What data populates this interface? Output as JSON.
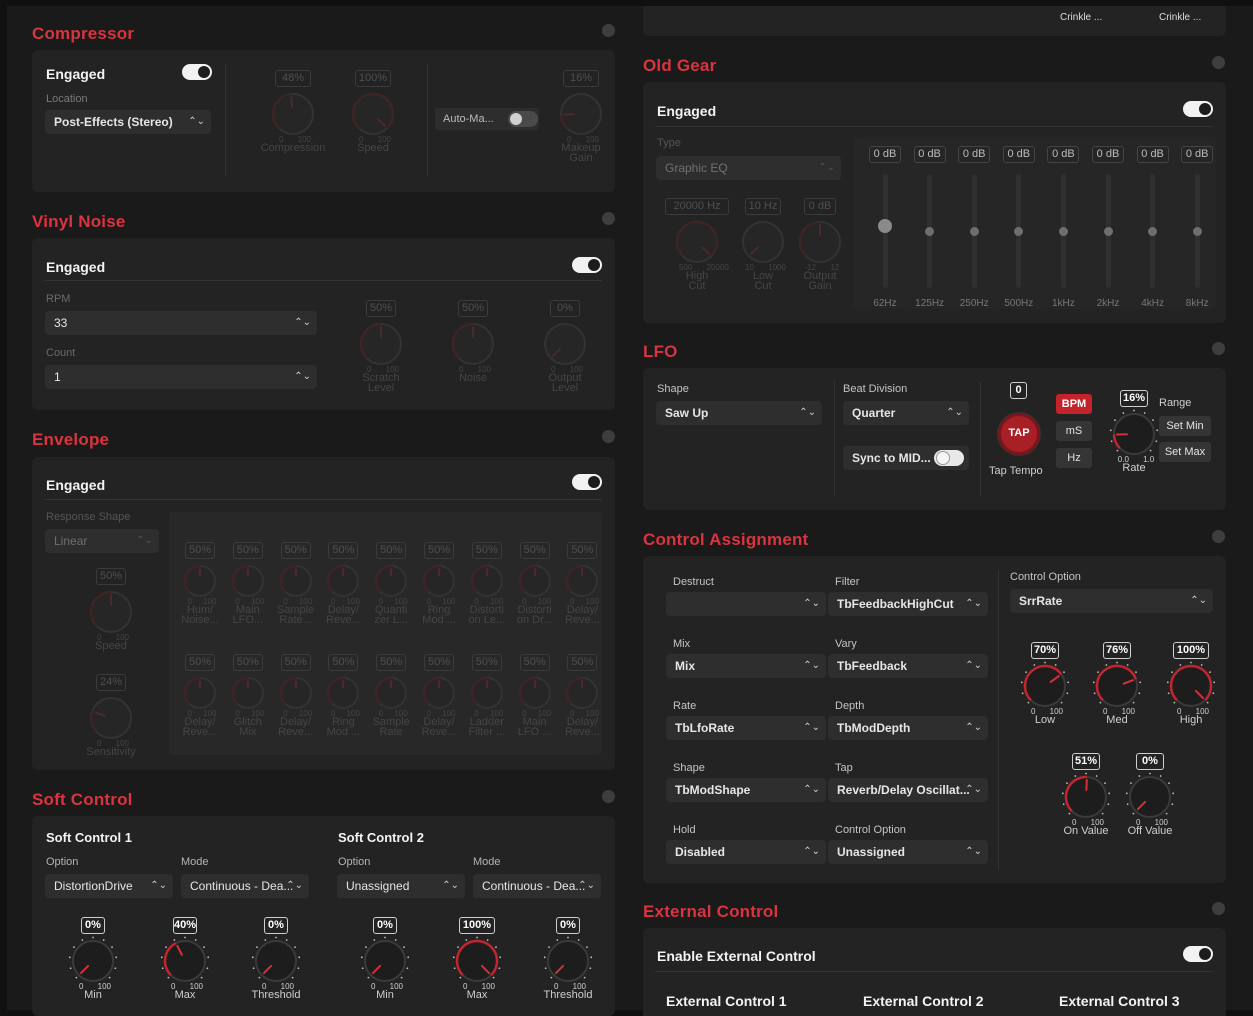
{
  "top_crinkle": [
    "Crinkle ...",
    "Crinkle ..."
  ],
  "compressor": {
    "title": "Compressor",
    "engaged": "Engaged",
    "location_label": "Location",
    "location": "Post-Effects (Stereo)",
    "auto_makeup": "Auto-Ma...",
    "knobs": [
      {
        "value": "48%",
        "label": "Compression",
        "pct": 0.48
      },
      {
        "value": "100%",
        "label": "Speed",
        "pct": 1.0
      },
      {
        "value": "16%",
        "label": "Makeup Gain",
        "pct": 0.16
      }
    ]
  },
  "vinyl": {
    "title": "Vinyl Noise",
    "engaged": "Engaged",
    "rpm_label": "RPM",
    "rpm": "33",
    "count_label": "Count",
    "count": "1",
    "knobs": [
      {
        "value": "50%",
        "label": "Scratch Level",
        "pct": 0.5
      },
      {
        "value": "50%",
        "label": "Noise",
        "pct": 0.5
      },
      {
        "value": "0%",
        "label": "Output Level",
        "pct": 0.0
      }
    ]
  },
  "envelope": {
    "title": "Envelope",
    "engaged": "Engaged",
    "shape_label": "Response Shape",
    "shape": "Linear",
    "speed": {
      "value": "50%",
      "label": "Speed",
      "pct": 0.5
    },
    "sens": {
      "value": "24%",
      "label": "Sensitivity",
      "pct": 0.24
    },
    "row1": [
      {
        "value": "50%",
        "l1": "Hum/",
        "l2": "Noise..."
      },
      {
        "value": "50%",
        "l1": "Main",
        "l2": "LFO..."
      },
      {
        "value": "50%",
        "l1": "Sample",
        "l2": "Rate..."
      },
      {
        "value": "50%",
        "l1": "Delay/",
        "l2": "Reve..."
      },
      {
        "value": "50%",
        "l1": "Quanti",
        "l2": "zer L..."
      },
      {
        "value": "50%",
        "l1": "Ring",
        "l2": "Mod ..."
      },
      {
        "value": "50%",
        "l1": "Distorti",
        "l2": "on Le..."
      },
      {
        "value": "50%",
        "l1": "Distorti",
        "l2": "on Dr..."
      },
      {
        "value": "50%",
        "l1": "Delay/",
        "l2": "Reve..."
      }
    ],
    "row2": [
      {
        "value": "50%",
        "l1": "Delay/",
        "l2": "Reve..."
      },
      {
        "value": "50%",
        "l1": "Glitch",
        "l2": "Mix"
      },
      {
        "value": "50%",
        "l1": "Delay/",
        "l2": "Reve..."
      },
      {
        "value": "50%",
        "l1": "Ring",
        "l2": "Mod ..."
      },
      {
        "value": "50%",
        "l1": "Sample",
        "l2": "Rate"
      },
      {
        "value": "50%",
        "l1": "Delay/",
        "l2": "Reve..."
      },
      {
        "value": "50%",
        "l1": "Ladder",
        "l2": "Filter ..."
      },
      {
        "value": "50%",
        "l1": "Main",
        "l2": "LFO ..."
      },
      {
        "value": "50%",
        "l1": "Delay/",
        "l2": "Reve..."
      }
    ]
  },
  "soft": {
    "title": "Soft Control",
    "sc1": {
      "title": "Soft Control 1",
      "option_label": "Option",
      "mode_label": "Mode",
      "option": "DistortionDrive",
      "mode": "Continuous - Dea...",
      "knobs": [
        {
          "value": "0%",
          "label": "Min",
          "pct": 0
        },
        {
          "value": "40%",
          "label": "Max",
          "pct": 0.4
        },
        {
          "value": "0%",
          "label": "Threshold",
          "pct": 0
        }
      ]
    },
    "sc2": {
      "title": "Soft Control 2",
      "option_label": "Option",
      "mode_label": "Mode",
      "option": "Unassigned",
      "mode": "Continuous - Dea...",
      "knobs": [
        {
          "value": "0%",
          "label": "Min",
          "pct": 0
        },
        {
          "value": "100%",
          "label": "Max",
          "pct": 1
        },
        {
          "value": "0%",
          "label": "Threshold",
          "pct": 0
        }
      ]
    }
  },
  "oldgear": {
    "title": "Old Gear",
    "engaged": "Engaged",
    "type_label": "Type",
    "type": "Graphic EQ",
    "knobs": [
      {
        "value": "20000 Hz",
        "label": "High Cut",
        "min": "500",
        "max": "20000",
        "pct": 1.0
      },
      {
        "value": "10 Hz",
        "label": "Low Cut",
        "min": "10",
        "max": "1000",
        "pct": 0.0
      },
      {
        "value": "0 dB",
        "label": "Output Gain",
        "min": "-12",
        "max": "12",
        "pct": 0.5
      }
    ],
    "bands": [
      {
        "value": "0 dB",
        "freq": "62Hz",
        "level": 0.5
      },
      {
        "value": "0 dB",
        "freq": "125Hz",
        "level": 0.5
      },
      {
        "value": "0 dB",
        "freq": "250Hz",
        "level": 0.5
      },
      {
        "value": "0 dB",
        "freq": "500Hz",
        "level": 0.5
      },
      {
        "value": "0 dB",
        "freq": "1kHz",
        "level": 0.5
      },
      {
        "value": "0 dB",
        "freq": "2kHz",
        "level": 0.5
      },
      {
        "value": "0 dB",
        "freq": "4kHz",
        "level": 0.5
      },
      {
        "value": "0 dB",
        "freq": "8kHz",
        "level": 0.5
      }
    ]
  },
  "lfo": {
    "title": "LFO",
    "shape_label": "Shape",
    "shape": "Saw Up",
    "beat_label": "Beat Division",
    "beat": "Quarter",
    "sync": "Sync to MID...",
    "tap_count": "0",
    "tap": "TAP",
    "tap_label": "Tap Tempo",
    "bpm": "BPM",
    "ms": "mS",
    "hz": "Hz",
    "rate": {
      "value": "16%",
      "label": "Rate",
      "min": "0.0",
      "max": "1.0",
      "pct": 0.16
    },
    "range_label": "Range",
    "set_min": "Set Min",
    "set_max": "Set Max"
  },
  "control": {
    "title": "Control Assignment",
    "fields": [
      {
        "label": "Destruct",
        "value": ""
      },
      {
        "label": "Filter",
        "value": "TbFeedbackHighCut"
      },
      {
        "label": "Mix",
        "value": "Mix"
      },
      {
        "label": "Vary",
        "value": "TbFeedback"
      },
      {
        "label": "Rate",
        "value": "TbLfoRate"
      },
      {
        "label": "Depth",
        "value": "TbModDepth"
      },
      {
        "label": "Shape",
        "value": "TbModShape"
      },
      {
        "label": "Tap",
        "value": "Reverb/Delay Oscillat..."
      },
      {
        "label": "Hold",
        "value": "Disabled"
      },
      {
        "label": "Control Option",
        "value": "Unassigned"
      }
    ],
    "option_label": "Control Option",
    "option": "SrrRate",
    "knobs": [
      {
        "value": "70%",
        "label": "Low",
        "pct": 0.7
      },
      {
        "value": "76%",
        "label": "Med",
        "pct": 0.76
      },
      {
        "value": "100%",
        "label": "High",
        "pct": 1.0
      },
      {
        "value": "51%",
        "label": "On Value",
        "pct": 0.51
      },
      {
        "value": "0%",
        "label": "Off Value",
        "pct": 0.0
      }
    ]
  },
  "external": {
    "title": "External Control",
    "enable": "Enable External Control",
    "cols": [
      "External Control 1",
      "External Control 2",
      "External Control 3"
    ]
  },
  "scale": {
    "min": "0",
    "max": "100"
  }
}
